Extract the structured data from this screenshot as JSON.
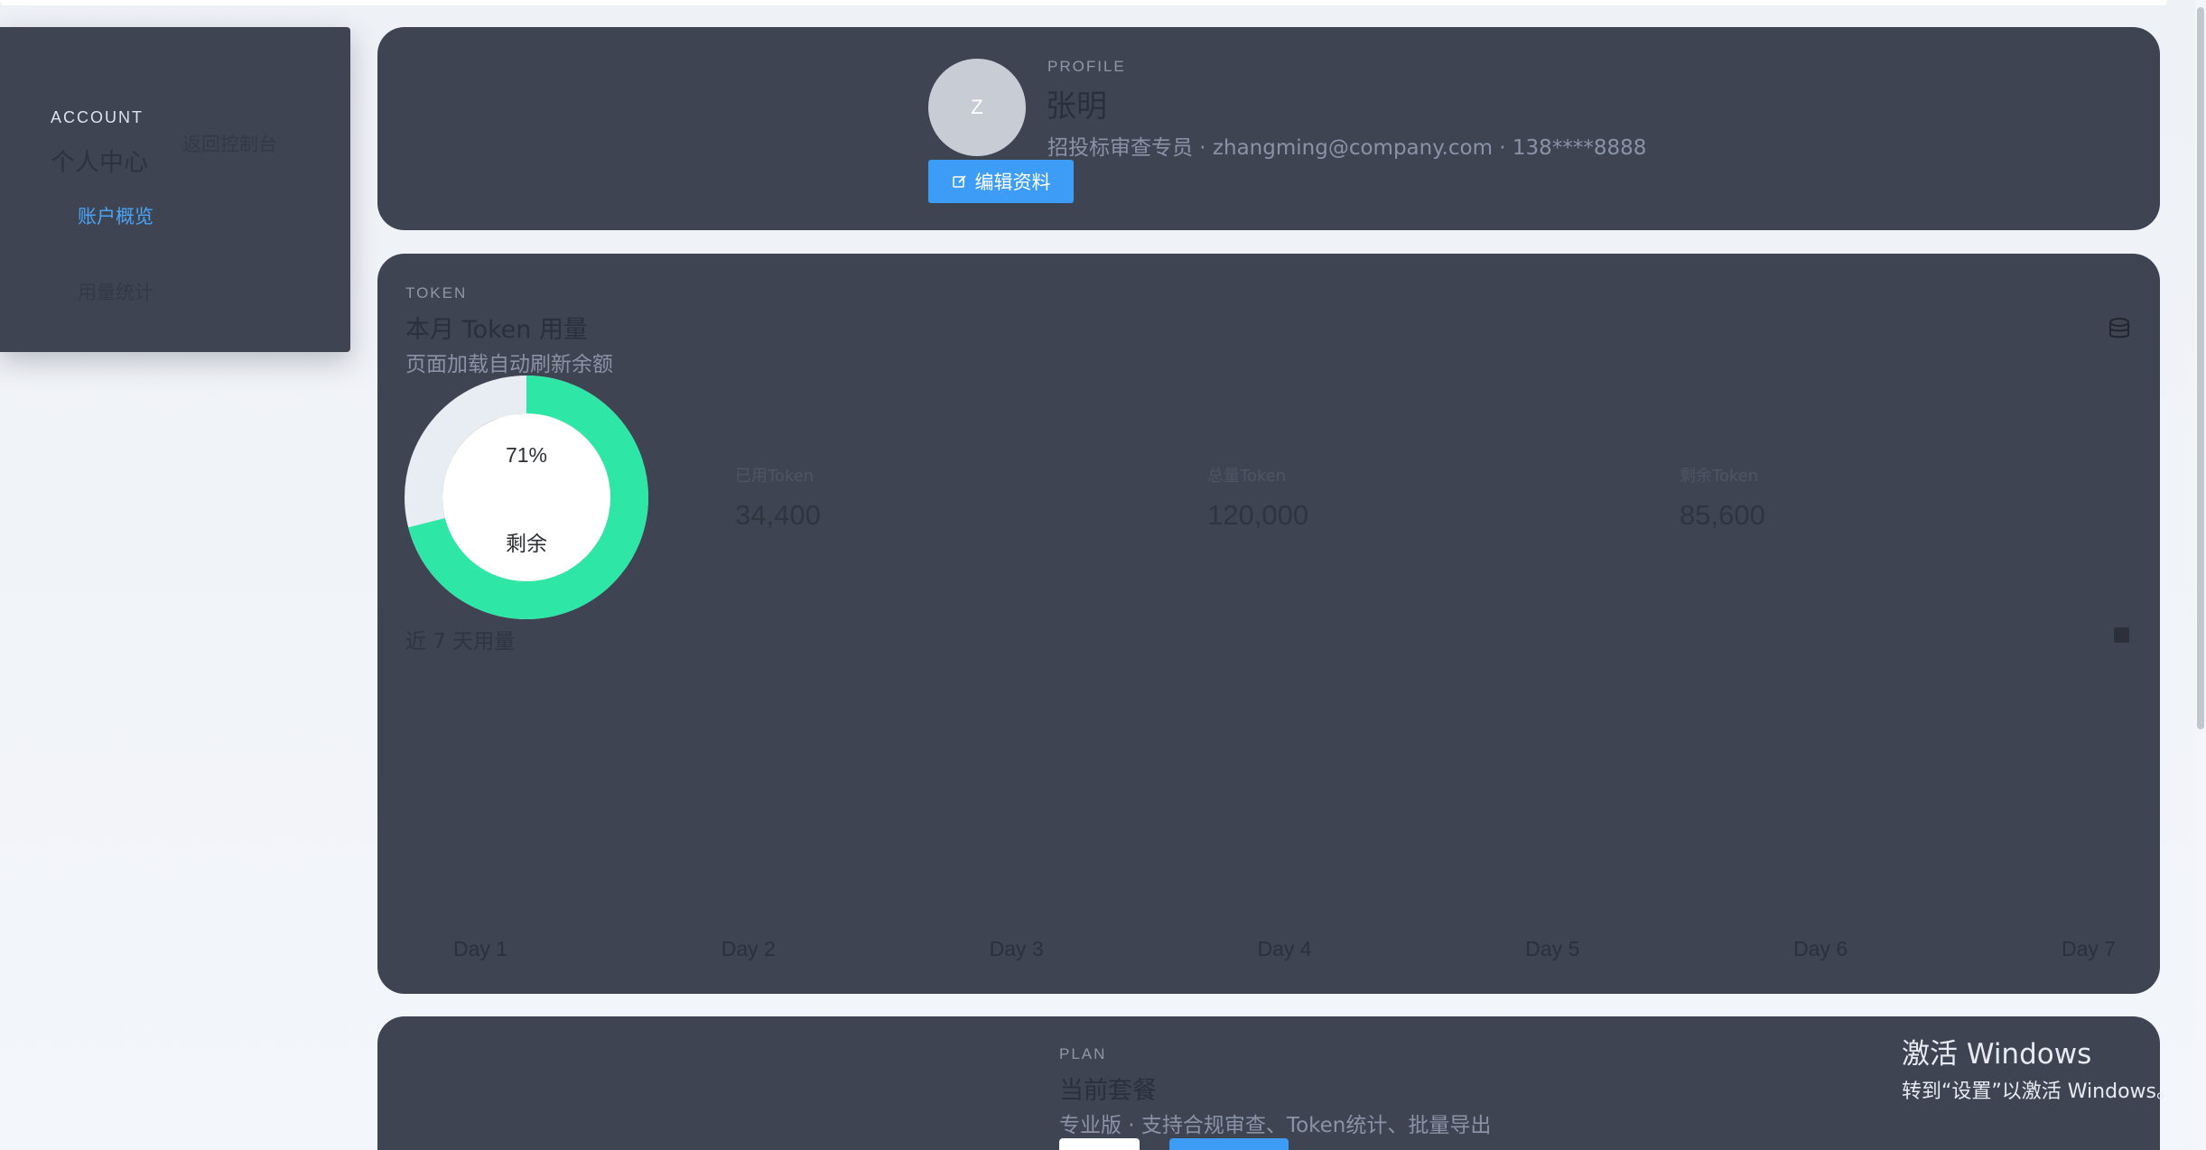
{
  "sidebar": {
    "eyebrow": "ACCOUNT",
    "title": "个人中心",
    "back_link": "返回控制台",
    "items": [
      {
        "label": "账户概览",
        "active": true
      },
      {
        "label": "用量统计",
        "active": false
      }
    ]
  },
  "profile": {
    "eyebrow": "PROFILE",
    "avatar_initial": "Z",
    "name": "张明",
    "meta": "招投标审查专员 · zhangming@company.com · 138****8888",
    "edit_button": "编辑资料",
    "edit_icon": "edit-icon"
  },
  "token": {
    "eyebrow": "TOKEN",
    "title": "本月 Token 用量",
    "subtitle": "页面加载自动刷新余额",
    "icon": "database-icon",
    "donut": {
      "percent_label": "71%",
      "caption": "剩余",
      "remaining_fraction": 0.71,
      "color_remaining": "#2ee6a6",
      "color_used": "#e8edf4"
    },
    "stats": [
      {
        "label": "已用Token",
        "value": "34,400"
      },
      {
        "label": "总量Token",
        "value": "120,000"
      },
      {
        "label": "剩余Token",
        "value": "85,600"
      }
    ],
    "chart_title": "近 7 天用量"
  },
  "chart_data": {
    "type": "line",
    "title": "近 7 天用量",
    "categories": [
      "Day 1",
      "Day 2",
      "Day 3",
      "Day 4",
      "Day 5",
      "Day 6",
      "Day 7"
    ],
    "series": [],
    "grid": false,
    "legend": "none"
  },
  "plan": {
    "eyebrow": "PLAN",
    "title": "当前套餐",
    "subtitle": "专业版 · 支持合规审查、Token统计、批量导出"
  },
  "watermark": {
    "line1": "激活 Windows",
    "line2": "转到“设置”以激活 Windows。"
  },
  "colors": {
    "card_bg": "#3f4453",
    "accent": "#3c9cf6",
    "page_bg": "#eef1f6"
  }
}
